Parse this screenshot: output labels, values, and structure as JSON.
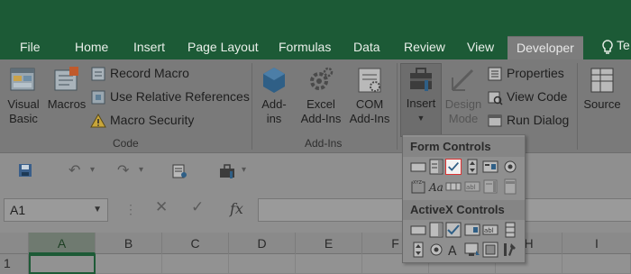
{
  "tabs": [
    {
      "label": "File"
    },
    {
      "label": "Home"
    },
    {
      "label": "Insert"
    },
    {
      "label": "Page Layout"
    },
    {
      "label": "Formulas"
    },
    {
      "label": "Data"
    },
    {
      "label": "Review"
    },
    {
      "label": "View"
    },
    {
      "label": "Developer",
      "active": true
    }
  ],
  "tell_me": {
    "label": "Te"
  },
  "code_group": {
    "label": "Code",
    "visual_basic": "Visual Basic",
    "macros": "Macros",
    "record_macro": "Record Macro",
    "use_relative": "Use Relative References",
    "macro_security": "Macro Security"
  },
  "addins_group": {
    "label": "Add-Ins",
    "addins": "Add-ins",
    "excel_addins": "Excel Add-Ins",
    "com_addins": "COM Add-Ins"
  },
  "controls_group": {
    "insert": "Insert",
    "design_mode": "Design Mode",
    "properties": "Properties",
    "view_code": "View Code",
    "run_dialog": "Run Dialog"
  },
  "source": {
    "label": "Source"
  },
  "insert_dropdown": {
    "form_controls_label": "Form Controls",
    "activex_controls_label": "ActiveX Controls",
    "form_controls": [
      "button",
      "combo-box",
      "check-box",
      "spin-button",
      "list-box",
      "option-button",
      "group-box",
      "label",
      "scroll-bar",
      "text-field",
      "combo-list-edit",
      "combo-drop-down-edit"
    ],
    "activex_controls": [
      "command-button",
      "combo-box",
      "check-box",
      "list-box",
      "text-box",
      "scroll-bar",
      "spin-button",
      "option-button",
      "label",
      "image",
      "toggle-button",
      "more-controls"
    ]
  },
  "formula_bar": {
    "name_box": "A1",
    "fx": "fx",
    "value": ""
  },
  "columns": [
    "A",
    "B",
    "C",
    "D",
    "E",
    "F",
    "G",
    "H",
    "I"
  ],
  "row_header": "1",
  "colors": {
    "tab_band": "#1c5a36",
    "ribbon": "#7a7a7a",
    "accent": "#1d5a36",
    "highlight_border": "#dd3333"
  }
}
